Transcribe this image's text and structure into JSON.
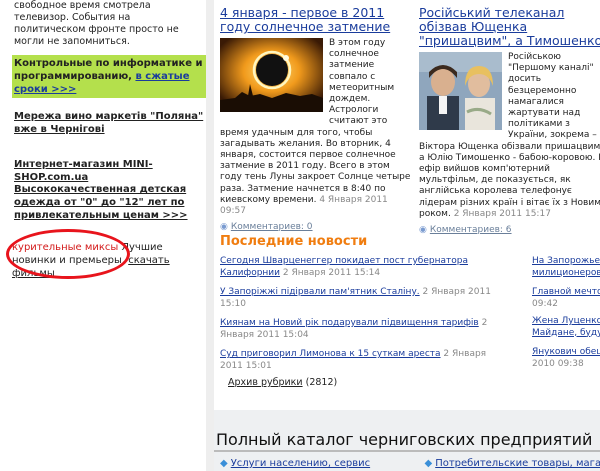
{
  "left": {
    "intro": "свободное время смотрела телевизор. События на политическом фронте просто не могли не запомниться.",
    "promo_text": "Контрольные по информатике и программированию, ",
    "promo_link": "в сжатые сроки >>>",
    "links": [
      "Мережа вино маркетів \"Поляна\" вже в Чернігові",
      "Интернет-магазин MINI-SHOP.com.ua",
      "Высококачественная детская одежда от \"0\" до \"12\" лет по привлекательным ценам >>>"
    ],
    "misc_red": "курительные миксы",
    "misc_mid": " Лучшие новинки и премьеры, ",
    "misc_link": "скачать фильмы"
  },
  "articles": [
    {
      "title": "4 января - первое в 2011 году солнечное затмение",
      "body": "В этом году солнечное затмение совпало с метеоритным дождем. Астрологи считают это время удачным для того, чтобы загадывать желания. Во вторник, 4 января, состоится первое солнечное затмение в 2011 году. Всего в этом году тень Луны закроет Солнце четыре раза. Затмение начнется в 8:40 по киевскому времени.",
      "date": "4 Января 2011 09:57",
      "comments": "Комментариев: 0"
    },
    {
      "title": "Російський телеканал обізвав Ющенка \"пришацвим\", а Тимошенко \"бабою-коровою\"",
      "body": "Російською \"Першому каналі\" досить безцеремонно намагалися жартувати над політиками з України, зокрема – Віктора Ющенка обізвали пришацвим, а Юлію Тимошенко - бабою-коровою. В ефір вийшов комп'ютерний мультфільм, де показується, як англійська королева телефонує лідерам різних країн і вітає їх з Новим роком.",
      "date": "2 Января 2011 15:17",
      "comments": "Комментариев: 6"
    }
  ],
  "latest": {
    "heading": "Последние новости",
    "items": [
      {
        "title": "Сегодня Шварценеггер покидает пост губернатора Калифорнии",
        "date": "2 Января 2011 15:14"
      },
      {
        "title": "У Запоріжжі підірвали пам'ятник Сталіну.",
        "date": "2 Января 2011 15:10"
      },
      {
        "title": "Киянам на Новий рік подарували підвищення тарифів",
        "date": "2 Января 2011 15:04"
      },
      {
        "title": "Суд приговорил Лимонова к 15 суткам ареста",
        "date": "2 Января 2011 15:01"
      }
    ],
    "right_items": [
      {
        "text": "На Запорожье м",
        "link": true
      },
      {
        "text": "милиционеров",
        "link": true
      },
      {
        "text": "Главной мечто",
        "link": true
      },
      {
        "text": "09:42",
        "link": false
      },
      {
        "text": "Жена Луценко",
        "link": true
      },
      {
        "text": "Майдане, будут",
        "link": true
      },
      {
        "text": "Янукович обещ",
        "link": true
      },
      {
        "text": "2010 09:38",
        "link": false
      }
    ],
    "archive_label": "Архив рубрики",
    "archive_count": "(2812)"
  },
  "catalog": {
    "title": "Полный каталог черниговских предприятий",
    "link1": "Услуги населению, сервис",
    "link2": "Потребительские товары, магазины"
  }
}
